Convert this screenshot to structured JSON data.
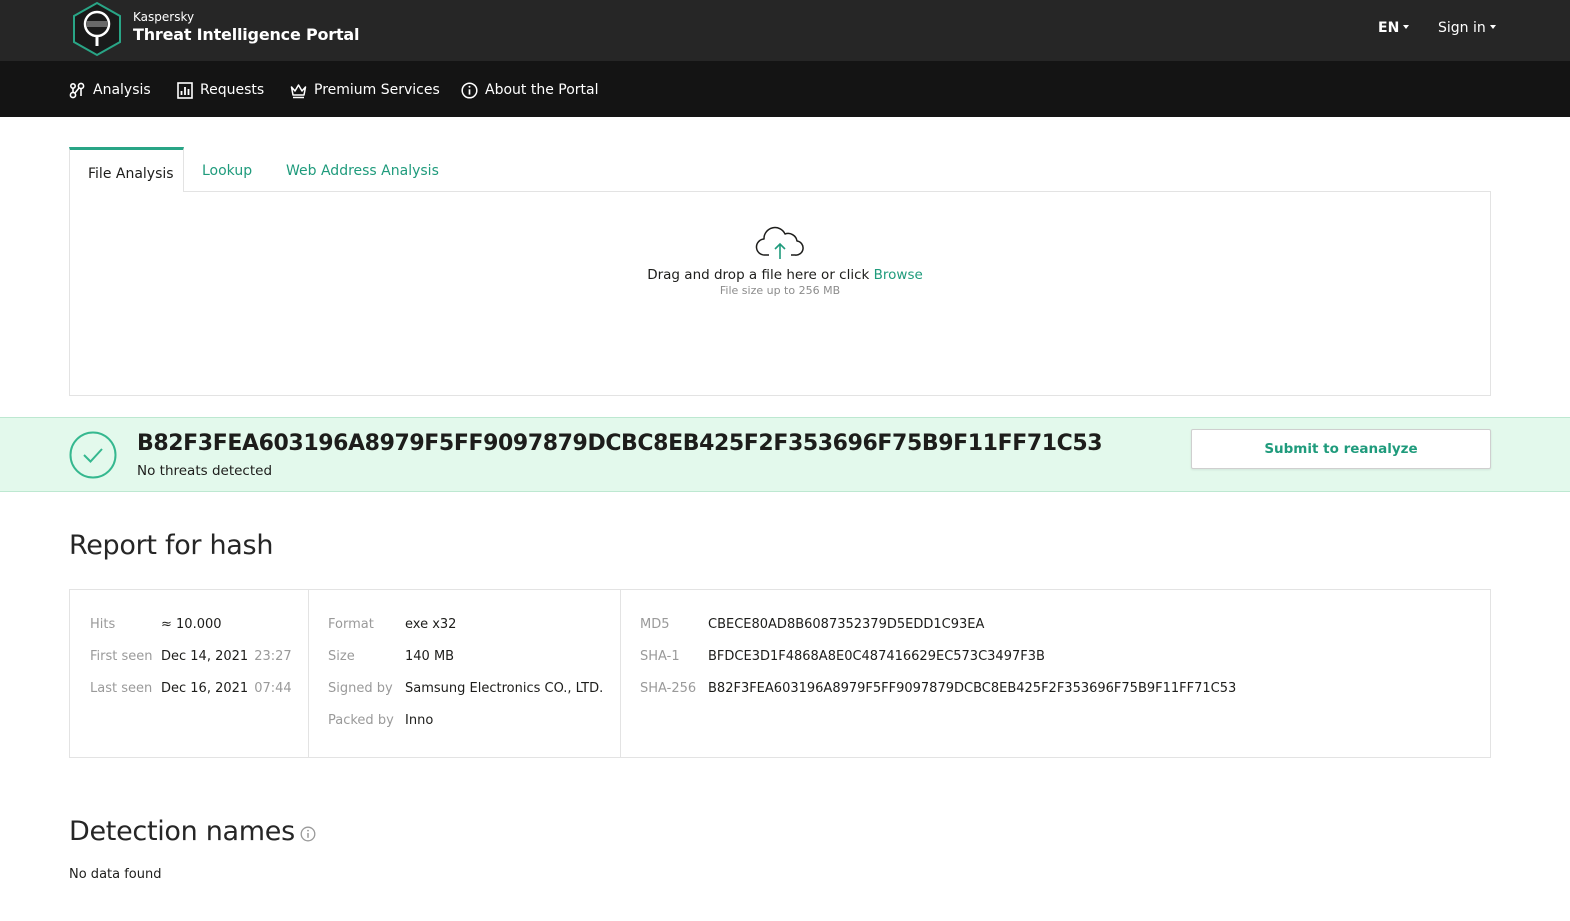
{
  "header": {
    "brand_small": "Kaspersky",
    "brand_big": "Threat Intelligence Portal",
    "logo_icon": "kaspersky-hexagon-logo",
    "language": "EN",
    "sign_in": "Sign in"
  },
  "nav": [
    {
      "label": "Analysis",
      "icon": "analysis-graph-icon"
    },
    {
      "label": "Requests",
      "icon": "requests-chart-icon"
    },
    {
      "label": "Premium Services",
      "icon": "crown-icon"
    },
    {
      "label": "About the Portal",
      "icon": "info-circle-icon"
    }
  ],
  "tabs": [
    {
      "label": "File Analysis",
      "active": true
    },
    {
      "label": "Lookup",
      "active": false
    },
    {
      "label": "Web Address Analysis",
      "active": false
    }
  ],
  "upload": {
    "icon": "cloud-upload-icon",
    "drop_text": "Drag and drop a file here or click",
    "browse_label": "Browse",
    "size_hint": "File size up to 256 MB"
  },
  "result": {
    "hash": "B82F3FEA603196A8979F5FF9097879DCBC8EB425F2F353696F75B9F11FF71C53",
    "status": "No threats detected",
    "status_icon": "check-circle-icon",
    "reanalyze_label": "Submit to reanalyze"
  },
  "report": {
    "title": "Report for hash",
    "stats": {
      "hits_label": "Hits",
      "hits_value": "≈ 10.000",
      "first_seen_label": "First seen",
      "first_seen_date": "Dec 14, 2021",
      "first_seen_time": "23:27",
      "last_seen_label": "Last seen",
      "last_seen_date": "Dec 16, 2021",
      "last_seen_time": "07:44"
    },
    "file": {
      "format_label": "Format",
      "format_value": "exe x32",
      "size_label": "Size",
      "size_value": "140 MB",
      "signed_label": "Signed by",
      "signed_value": "Samsung Electronics CO., LTD.",
      "packed_label": "Packed by",
      "packed_value": "Inno"
    },
    "hashes": {
      "md5_label": "MD5",
      "md5_value": "CBECE80AD8B6087352379D5EDD1C93EA",
      "sha1_label": "SHA-1",
      "sha1_value": "BFDCE3D1F4868A8E0C487416629EC573C3497F3B",
      "sha256_label": "SHA-256",
      "sha256_value": "B82F3FEA603196A8979F5FF9097879DCBC8EB425F2F353696F75B9F11FF71C53"
    }
  },
  "detection": {
    "title": "Detection names",
    "info_icon": "info-circle-icon",
    "empty_text": "No data found"
  },
  "colors": {
    "accent": "#1f9b7c",
    "topbar": "#262626",
    "navbar": "#141414",
    "banner": "#e3f9ec"
  }
}
